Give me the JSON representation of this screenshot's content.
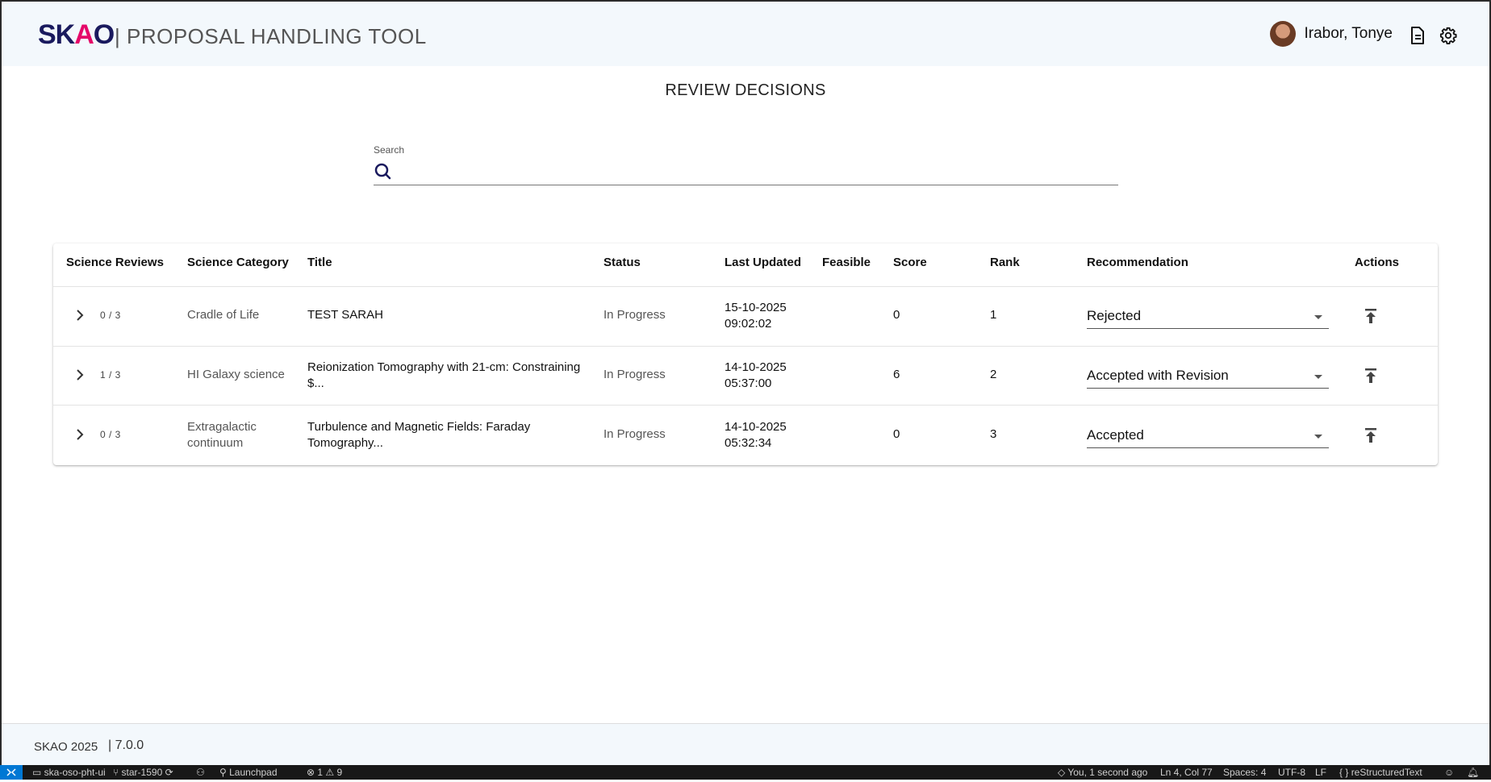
{
  "header": {
    "logo_parts": [
      "SK",
      "A",
      "O"
    ],
    "app_title": "| PROPOSAL HANDLING TOOL",
    "user_name": "Irabor, Tonye"
  },
  "page": {
    "title": "REVIEW DECISIONS"
  },
  "search": {
    "label": "Search",
    "value": "",
    "placeholder": ""
  },
  "table": {
    "columns": [
      "Science Reviews",
      "Science Category",
      "Title",
      "Status",
      "Last Updated",
      "Feasible",
      "Score",
      "Rank",
      "Recommendation",
      "Actions"
    ],
    "rows": [
      {
        "reviews": "0 / 3",
        "category": "Cradle of Life",
        "title_l1": "TEST SARAH",
        "title_l2": "",
        "status": "In Progress",
        "date": "15-10-2025",
        "time": "09:02:02",
        "feasible": "",
        "score": "0",
        "rank": "1",
        "recommendation": "Rejected"
      },
      {
        "reviews": "1 / 3",
        "category": "HI Galaxy science",
        "title_l1": "Reionization Tomography with 21-cm: Constraining",
        "title_l2": "$...",
        "status": "In Progress",
        "date": "14-10-2025",
        "time": "05:37:00",
        "feasible": "",
        "score": "6",
        "rank": "2",
        "recommendation": "Accepted with Revision"
      },
      {
        "reviews": "0 / 3",
        "category_l1": "Extragalactic",
        "category_l2": "continuum",
        "title_l1": "Turbulence and Magnetic Fields: Faraday",
        "title_l2": "Tomography...",
        "status": "In Progress",
        "date": "14-10-2025",
        "time": "05:32:34",
        "feasible": "",
        "score": "0",
        "rank": "3",
        "recommendation": "Accepted"
      }
    ]
  },
  "footer": {
    "copyright": "SKAO 2025",
    "version": "|  7.0.0"
  },
  "statusbar": {
    "repo": "ska-oso-pht-ui",
    "branch": "star-1590",
    "launchpad": "Launchpad",
    "problems": "1",
    "warnings": "9",
    "blame": "You, 1 second ago",
    "position": "Ln 4, Col 77",
    "spaces": "Spaces: 4",
    "encoding": "UTF-8",
    "eol": "LF",
    "language": "reStructuredText"
  },
  "colors": {
    "brand_navy": "#1a1a5e",
    "brand_pink": "#e50869",
    "header_bg": "#f3f8fc",
    "statusbar_bg": "#181818",
    "remote_blue": "#0078d4"
  },
  "icons": [
    "search-icon",
    "document-icon",
    "gear-icon",
    "chevron-right-icon",
    "publish-icon",
    "avatar"
  ]
}
